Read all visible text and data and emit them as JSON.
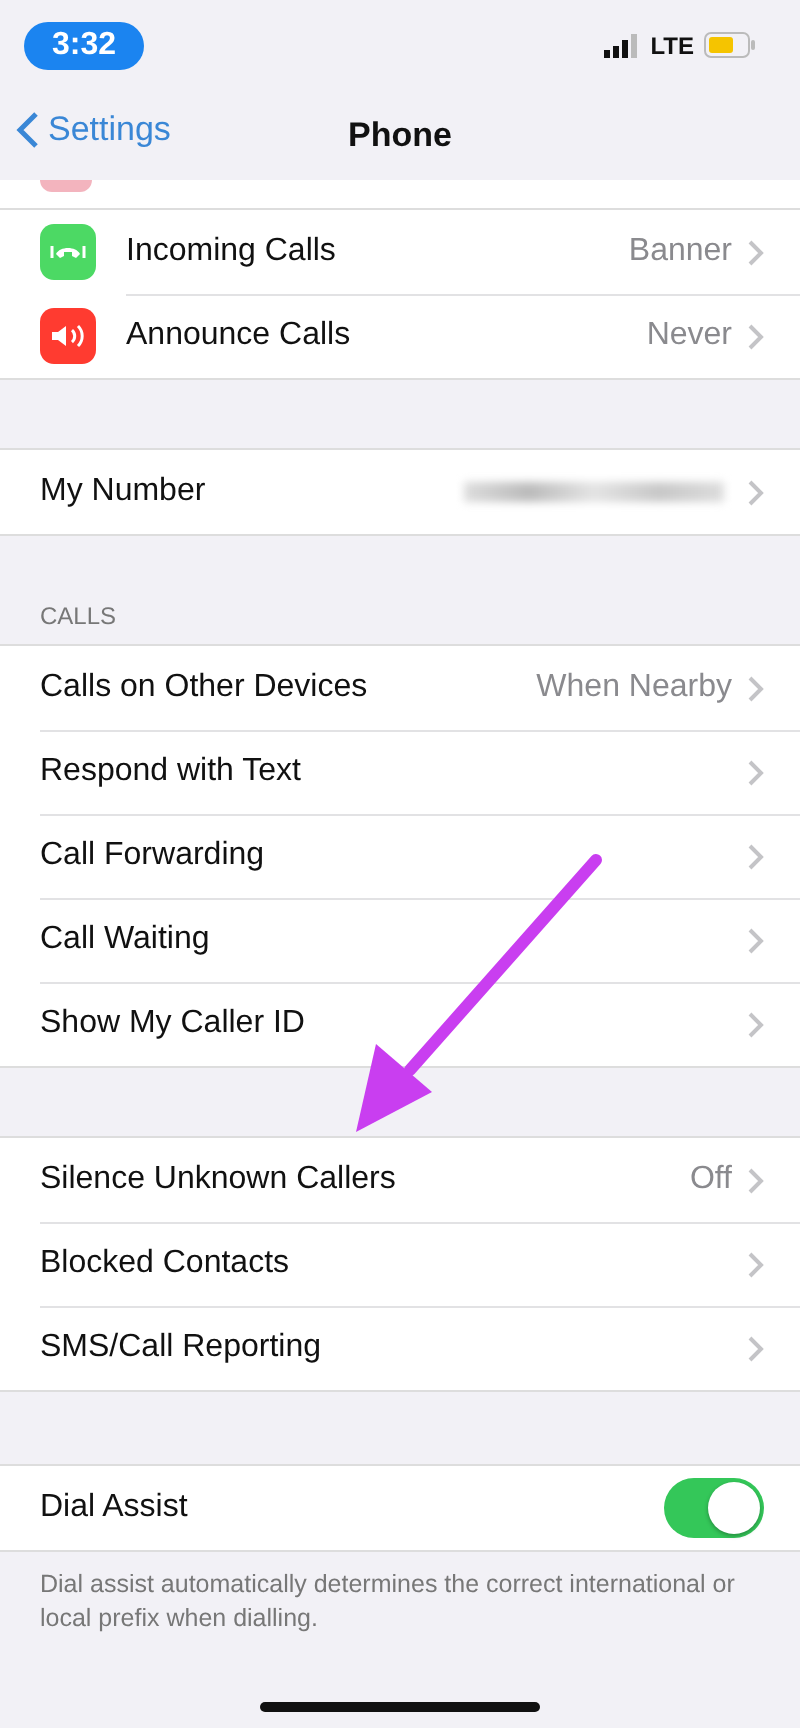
{
  "status_bar": {
    "time": "3:32",
    "network": "LTE"
  },
  "nav": {
    "back": "Settings",
    "title": "Phone"
  },
  "groups": [
    {
      "rows": [
        {
          "kind": "chevron",
          "color": "#4cd964",
          "label": "Incoming Calls",
          "value": "Banner"
        },
        {
          "kind": "chevron",
          "color": "#ff3b30",
          "label": "Announce Calls",
          "value": "Never"
        }
      ]
    },
    {
      "rows": [
        {
          "kind": "redacted",
          "label": "My Number"
        }
      ]
    },
    {
      "header": "CALLS",
      "rows": [
        {
          "kind": "chevron",
          "label": "Calls on Other Devices",
          "value": "When Nearby"
        },
        {
          "kind": "chevron",
          "label": "Respond with Text"
        },
        {
          "kind": "chevron",
          "label": "Call Forwarding"
        },
        {
          "kind": "chevron",
          "label": "Call Waiting"
        },
        {
          "kind": "chevron",
          "label": "Show My Caller ID"
        }
      ]
    },
    {
      "rows": [
        {
          "kind": "chevron",
          "label": "Silence Unknown Callers",
          "value": "Off"
        },
        {
          "kind": "chevron",
          "label": "Blocked Contacts"
        },
        {
          "kind": "chevron",
          "label": "SMS/Call Reporting"
        }
      ]
    },
    {
      "rows": [
        {
          "kind": "toggle",
          "label": "Dial Assist",
          "on": true
        }
      ],
      "footer": "Dial assist automatically determines the correct international or local prefix when dialling."
    }
  ]
}
